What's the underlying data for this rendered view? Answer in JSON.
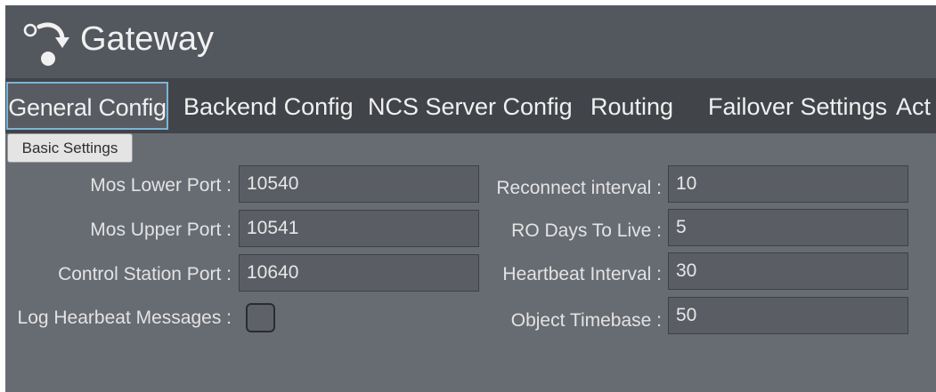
{
  "app": {
    "title": "Gateway",
    "logo_icon": "gateway-logo-icon"
  },
  "tabs": [
    {
      "label": "General Config",
      "active": true
    },
    {
      "label": "Backend Config",
      "active": false
    },
    {
      "label": "NCS Server Config",
      "active": false
    },
    {
      "label": "Routing",
      "active": false
    },
    {
      "label": "Failover Settings",
      "active": false
    },
    {
      "label": "Act",
      "active": false
    }
  ],
  "section": {
    "label": "Basic Settings"
  },
  "left_fields": [
    {
      "label": "Mos Lower Port :",
      "value": "10540"
    },
    {
      "label": "Mos Upper Port :",
      "value": "10541"
    },
    {
      "label": "Control Station Port :",
      "value": "10640"
    }
  ],
  "checkbox": {
    "label": "Log Hearbeat Messages :",
    "checked": false
  },
  "right_fields": [
    {
      "label": "Reconnect interval :",
      "value": "10"
    },
    {
      "label": "RO Days To Live :",
      "value": "5"
    },
    {
      "label": "Heartbeat Interval :",
      "value": "30"
    },
    {
      "label": "Object Timebase :",
      "value": "50"
    }
  ],
  "colors": {
    "titlebar": "#53575e",
    "tabbar": "#414449",
    "panel": "#676b72",
    "active_tab_border": "#7cb4d6"
  }
}
